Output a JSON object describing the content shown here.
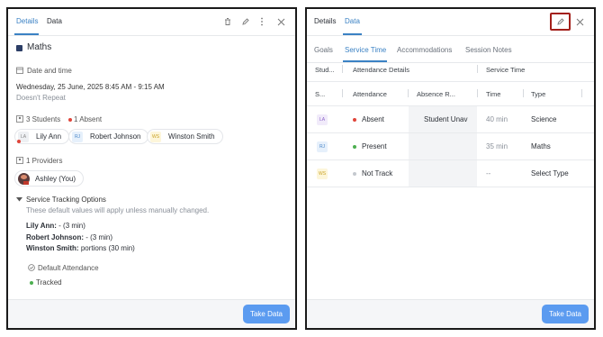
{
  "left": {
    "tabs": [
      "Details",
      "Data"
    ],
    "title": "Maths",
    "date_label": "Date and time",
    "date_value": "Wednesday, 25 June, 2025 8:45 AM - 9:15 AM",
    "repeat": "Doesn't Repeat",
    "students_label": "3 Students",
    "absent_label": "1 Absent",
    "students": [
      {
        "initials": "LA",
        "name": "Lily Ann"
      },
      {
        "initials": "RJ",
        "name": "Robert Johnson"
      },
      {
        "initials": "WS",
        "name": "Winston Smith"
      }
    ],
    "providers_label": "1 Providers",
    "provider_name": "Ashley (You)",
    "tracking_title": "Service Tracking Options",
    "tracking_desc": "These default values will apply unless manually changed.",
    "tracking_lines": [
      {
        "name": "Lily Ann:",
        "value": " - (3 min)"
      },
      {
        "name": "Robert Johnson:",
        "value": " - (3 min)"
      },
      {
        "name": "Winston Smith:",
        "value": " portions (30 min)"
      }
    ],
    "default_attendance_label": "Default Attendance",
    "default_attendance_value": "Tracked",
    "take_data": "Take Data"
  },
  "right": {
    "tabs": [
      "Details",
      "Data"
    ],
    "subtabs": [
      "Goals",
      "Service Time",
      "Accommodations",
      "Session Notes"
    ],
    "group_headers": [
      "Stud...",
      "Attendance Details",
      "Service Time"
    ],
    "col_headers": [
      "S...",
      "Attendance",
      "Absence R...",
      "Time",
      "Type"
    ],
    "rows": [
      {
        "initials": "LA",
        "attendance": "Absent",
        "reason": "Student Unav",
        "time": "40 min",
        "type": "Science"
      },
      {
        "initials": "RJ",
        "attendance": "Present",
        "reason": "",
        "time": "35 min",
        "type": "Maths"
      },
      {
        "initials": "WS",
        "attendance": "Not Track",
        "reason": "",
        "time": "--",
        "type": "Select Type"
      }
    ],
    "take_data": "Take Data"
  },
  "colors": {
    "accent": "#3b82c4",
    "button": "#5b9bf0",
    "absent": "#e0453a",
    "present": "#4caf50",
    "not_tracked": "#c4c8ce",
    "highlight_border": "#a3201b"
  }
}
